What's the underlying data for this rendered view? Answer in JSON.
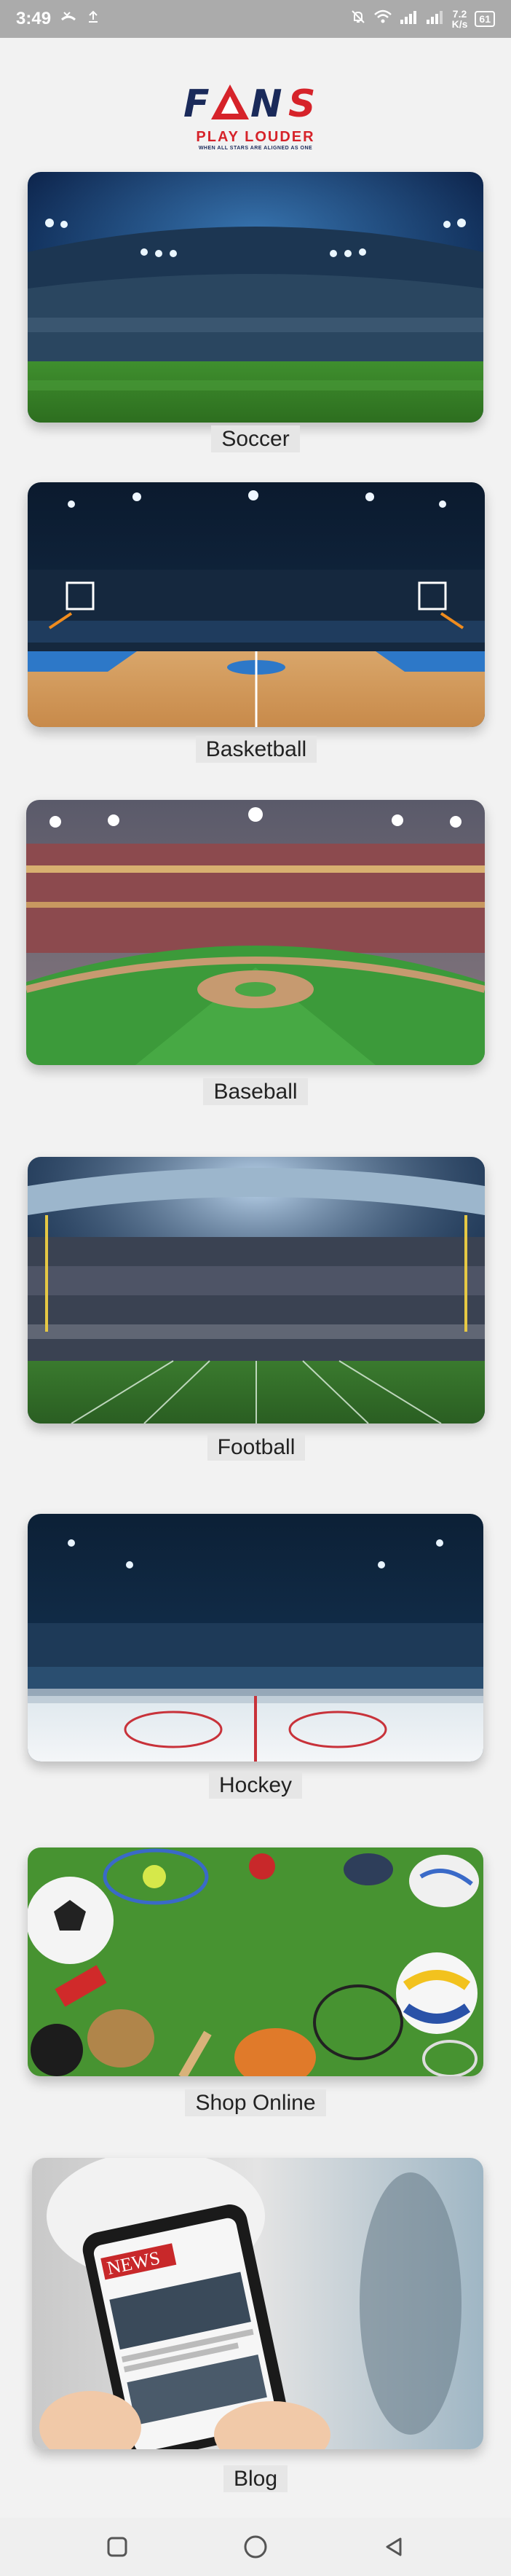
{
  "status_bar": {
    "time": "3:49",
    "net_speed_value": "7.2",
    "net_speed_unit": "K/s",
    "battery": "61"
  },
  "logo": {
    "brand": "FANS",
    "tagline": "PLAY LOUDER",
    "subtagline": "WHEN ALL STARS ARE ALIGNED AS ONE"
  },
  "categories": [
    {
      "label": "Soccer"
    },
    {
      "label": "Basketball"
    },
    {
      "label": "Baseball"
    },
    {
      "label": "Football"
    },
    {
      "label": "Hockey"
    },
    {
      "label": "Shop Online"
    },
    {
      "label": "Blog",
      "image_text": "NEWS"
    }
  ],
  "colors": {
    "brand_red": "#d6232a",
    "brand_navy": "#1a2a5a",
    "background": "#f2f2f2"
  }
}
